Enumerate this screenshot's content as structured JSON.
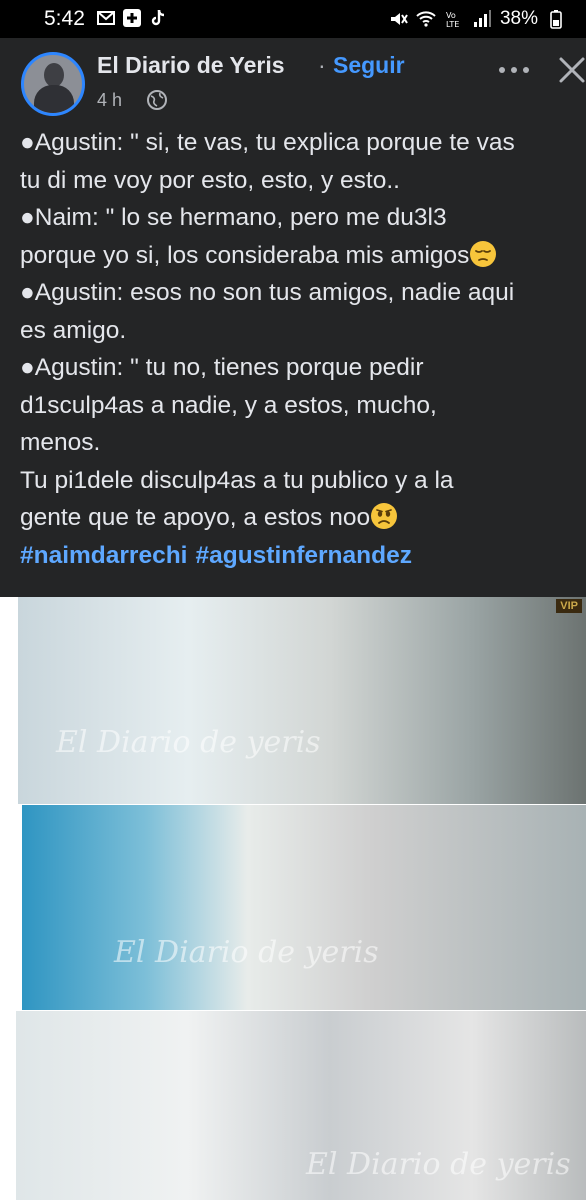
{
  "status_bar": {
    "time": "5:42",
    "battery": "38%",
    "icons": [
      "gmail-icon",
      "health-plus-icon",
      "tiktok-icon",
      "mute-icon",
      "wifi-calling-icon",
      "volte-icon",
      "signal-icon",
      "battery-icon"
    ]
  },
  "post": {
    "page_name": "El Diario de Yeris",
    "separator": "·",
    "follow_label": "Seguir",
    "time_ago": "4 h",
    "privacy_icon": "globe-icon",
    "menu_icon": "more-icon",
    "close_icon": "close-icon",
    "text_lines": [
      "●Agustin: \" si, te vas, tu explica porque te vas",
      "tu di me voy por esto, esto, y esto..",
      "●Naim: \" lo se hermano, pero me du3l3",
      "porque yo si, los consideraba mis amigos",
      "●Agustin: esos no son tus amigos, nadie aqui",
      "es amigo.",
      "●Agustin: \" tu no, tienes porque pedir",
      "d1sculp4as a nadie, y a estos, mucho,",
      "menos.",
      "Tu pi1dele disculp4as a tu publico y a la",
      "gente que te apoyo, a estos noo"
    ],
    "hashtags": [
      "#naimdarrechi",
      "#agustinfernandez"
    ],
    "emoji_pensive": "pensive-face-emoji",
    "emoji_frowning": "frowning-face-emoji"
  },
  "photos": {
    "watermark": "El Diario de yeris",
    "badge": "VIP"
  },
  "colors": {
    "background": "#242526",
    "link": "#4599ff",
    "hashtag": "#5ea8ff",
    "avatar_ring": "#2d86ff"
  }
}
